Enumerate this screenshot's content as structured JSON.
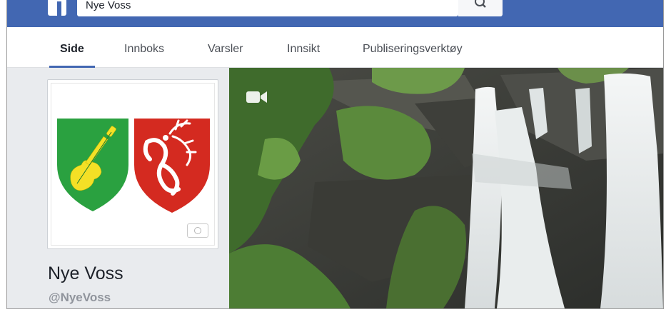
{
  "search": {
    "value": "Nye Voss"
  },
  "tabs": [
    {
      "label": "Side",
      "active": true
    },
    {
      "label": "Innboks",
      "active": false
    },
    {
      "label": "Varsler",
      "active": false
    },
    {
      "label": "Innsikt",
      "active": false
    },
    {
      "label": "Publiseringsverktøy",
      "active": false
    }
  ],
  "page": {
    "name": "Nye Voss",
    "handle": "@NyeVoss"
  },
  "icons": {
    "logo": "facebook-logo",
    "search": "magnifier",
    "cover_video": "video-camera",
    "profile_camera": "camera"
  },
  "colors": {
    "brand_blue": "#4267b2",
    "shield_green": "#2aa140",
    "shield_red": "#d42a20",
    "violin_yellow": "#f4e026"
  }
}
